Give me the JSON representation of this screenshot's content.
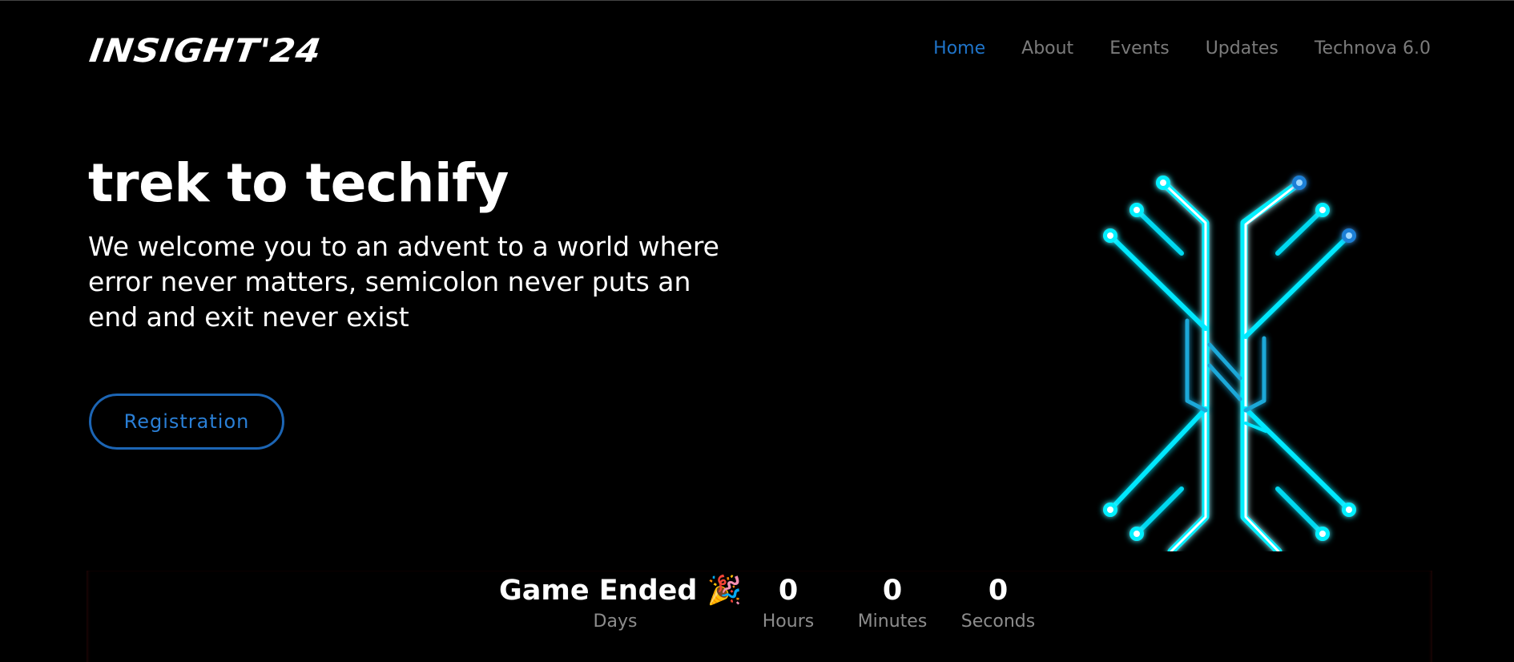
{
  "header": {
    "logo": "INSIGHT'24",
    "nav": [
      {
        "label": "Home",
        "active": true
      },
      {
        "label": "About",
        "active": false
      },
      {
        "label": "Events",
        "active": false
      },
      {
        "label": "Updates",
        "active": false
      },
      {
        "label": "Technova 6.0",
        "active": false
      }
    ]
  },
  "hero": {
    "title": "trek to techify",
    "subtitle": "We welcome you to an advent to a world where error never matters, semicolon never puts an end and exit never exist",
    "register_label": "Registration"
  },
  "countdown": {
    "status": "Game Ended 🎉",
    "days_label": "Days",
    "hours_value": "0",
    "hours_label": "Hours",
    "minutes_value": "0",
    "minutes_label": "Minutes",
    "seconds_value": "0",
    "seconds_label": "Seconds"
  },
  "colors": {
    "background": "#000000",
    "accent": "#1f74c9",
    "nav_text": "#7b7b7b",
    "logo_glow": "#00e5ff"
  },
  "icons": {
    "hero_logo": "circuit-x-logo-icon"
  }
}
